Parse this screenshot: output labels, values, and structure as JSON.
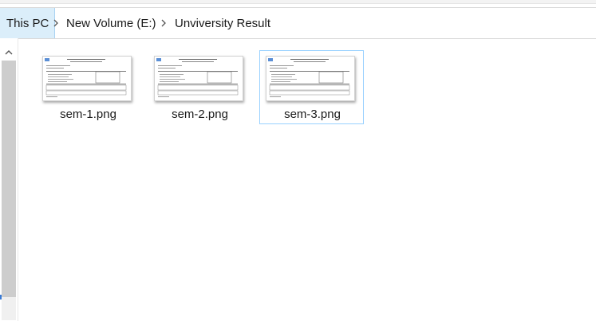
{
  "breadcrumb": {
    "items": [
      "This PC",
      "New Volume (E:)",
      "Unviversity Result"
    ]
  },
  "files": [
    {
      "name": "sem-1.png",
      "selected": false
    },
    {
      "name": "sem-2.png",
      "selected": false
    },
    {
      "name": "sem-3.png",
      "selected": true
    }
  ],
  "icons": {
    "separator": "chevron-right-icon",
    "scroll_up": "chevron-up-icon"
  },
  "colors": {
    "crumb_active_bg": "#dbeefa",
    "selection_border": "#99d1ff",
    "scrollbar_thumb": "#cdcdcd"
  }
}
